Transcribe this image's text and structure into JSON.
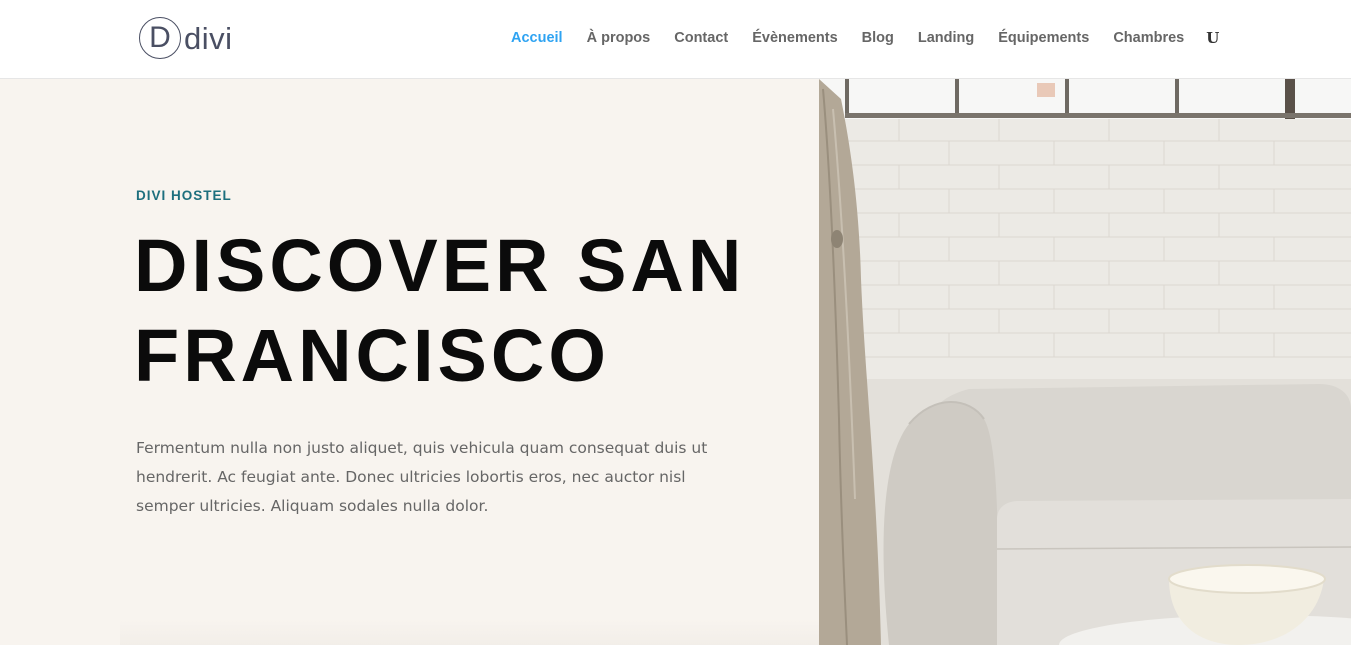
{
  "header": {
    "logo": {
      "mark": "D",
      "text": "divi"
    },
    "nav": {
      "items": [
        {
          "label": "Accueil",
          "active": true
        },
        {
          "label": "À propos"
        },
        {
          "label": "Contact"
        },
        {
          "label": "Évènements"
        },
        {
          "label": "Blog"
        },
        {
          "label": "Landing"
        },
        {
          "label": "Équipements"
        },
        {
          "label": "Chambres"
        }
      ],
      "more_label": "U"
    }
  },
  "hero": {
    "eyebrow": "DIVI HOSTEL",
    "headline": "DISCOVER SAN FRANCISCO",
    "body": "Fermentum nulla non justo aliquet, quis vehicula quam consequat duis ut hendrerit. Ac feugiat ante. Donec ultricies lobortis eros, nec auctor nisl semper ultricies. Aliquam sodales nulla dolor."
  },
  "colors": {
    "accent": "#2ea3f2",
    "eyebrow": "#1d6f7e",
    "hero_bg": "#f8f4ef",
    "headline": "#0b0b0b",
    "body_text": "#666666",
    "nav_text": "#666666"
  },
  "icons": {
    "logo": "divi-logo-icon",
    "menu_more": "menu-more-icon"
  }
}
